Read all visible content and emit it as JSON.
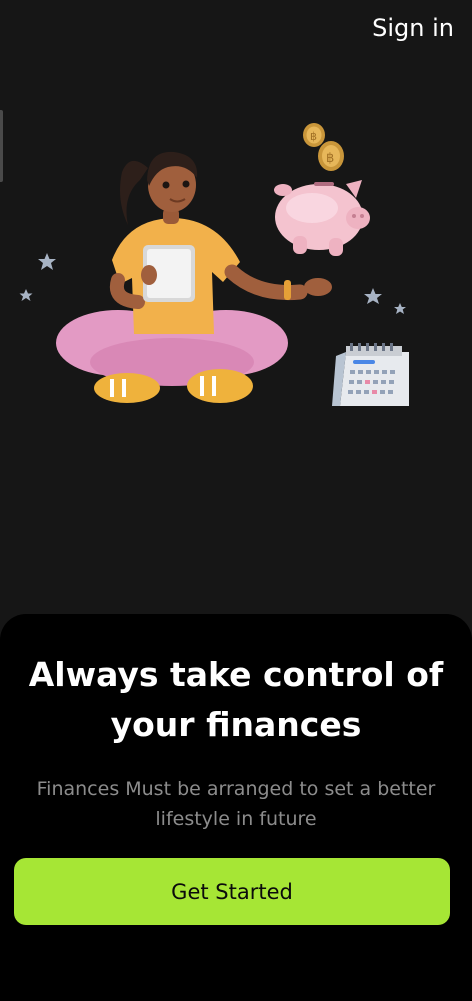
{
  "header": {
    "sign_in_label": "Sign in"
  },
  "onboarding": {
    "headline": "Always take control of your finances",
    "subtitle": "Finances Must be arranged to set a better lifestyle in future",
    "cta_label": "Get Started"
  },
  "illustration": {
    "icons": [
      "woman-with-tablet-icon",
      "piggy-bank-icon",
      "coin-icon",
      "calendar-icon",
      "star-icon"
    ],
    "colors": {
      "accent": "#a6e635",
      "background": "#161616",
      "sheet": "#000000"
    }
  }
}
